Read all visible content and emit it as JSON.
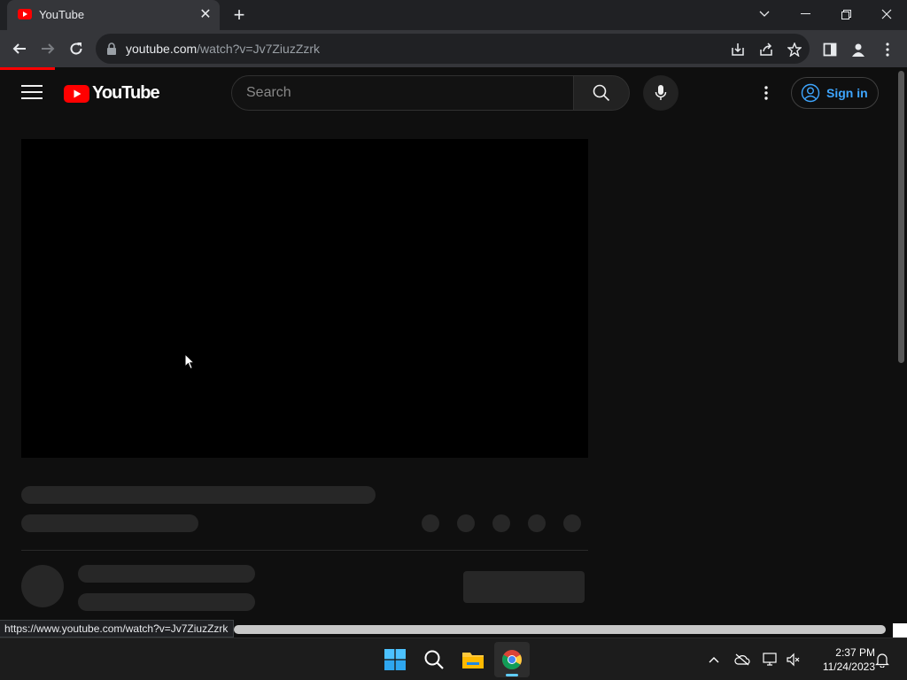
{
  "browser": {
    "tab_title": "YouTube",
    "url_host": "youtube.com",
    "url_path": "/watch?v=Jv7ZiuzZzrk",
    "status_url": "https://www.youtube.com/watch?v=Jv7ZiuzZzrk"
  },
  "youtube": {
    "logo_text": "YouTube",
    "search_placeholder": "Search",
    "signin_label": "Sign in",
    "brand_red": "#ff0000",
    "link_blue": "#3ea6ff"
  },
  "taskbar": {
    "time": "2:37 PM",
    "date": "11/24/2023"
  }
}
